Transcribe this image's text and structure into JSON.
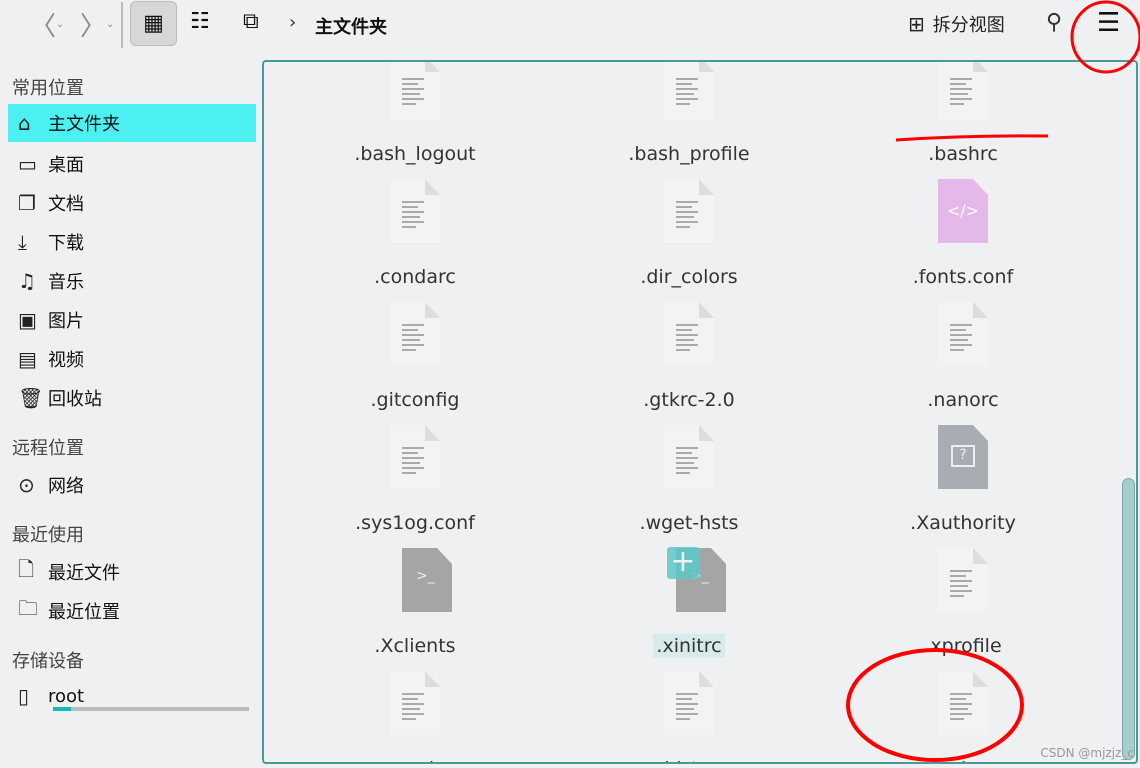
{
  "toolbar": {
    "back_icon": "chevron-left-icon",
    "forward_icon": "chevron-right-icon",
    "breadcrumb": "主文件夹",
    "split_view": "拆分视图",
    "search_icon": "search-icon",
    "menu_icon": "hamburger-menu-icon"
  },
  "sidebar": {
    "sections": [
      "常用位置",
      "远程位置",
      "最近使用",
      "存储设备"
    ],
    "places": [
      {
        "label": "主文件夹",
        "icon": "home-icon"
      },
      {
        "label": "桌面",
        "icon": "desktop-icon"
      },
      {
        "label": "文档",
        "icon": "documents-icon"
      },
      {
        "label": "下载",
        "icon": "download-icon"
      },
      {
        "label": "音乐",
        "icon": "music-icon"
      },
      {
        "label": "图片",
        "icon": "picture-icon"
      },
      {
        "label": "视频",
        "icon": "video-icon"
      },
      {
        "label": "回收站",
        "icon": "trash-icon"
      }
    ],
    "remote": [
      {
        "label": "网络",
        "icon": "network-icon"
      }
    ],
    "recent": [
      {
        "label": "最近文件",
        "icon": "recent-file-icon"
      },
      {
        "label": "最近位置",
        "icon": "recent-folder-icon"
      }
    ],
    "devices": [
      {
        "label": "root",
        "icon": "drive-icon",
        "usage_fraction": 0.09
      }
    ]
  },
  "files": [
    ".bash_logout",
    ".bash_profile",
    ".bashrc",
    ".condarc",
    ".dir_colors",
    ".fonts.conf",
    ".gitconfig",
    ".gtkrc-2.0",
    ".nanorc",
    ".sys1og.conf",
    ".wget-hsts",
    ".Xauthority",
    ".Xclients",
    ".xinitrc",
    ".xprofile",
    ".zcompdump",
    ".zhistory",
    ".zshrc"
  ],
  "watermark": "CSDN @mjzjz_c",
  "colors": {
    "accent": "#4cf0f0",
    "annotation": "#ff0000"
  }
}
